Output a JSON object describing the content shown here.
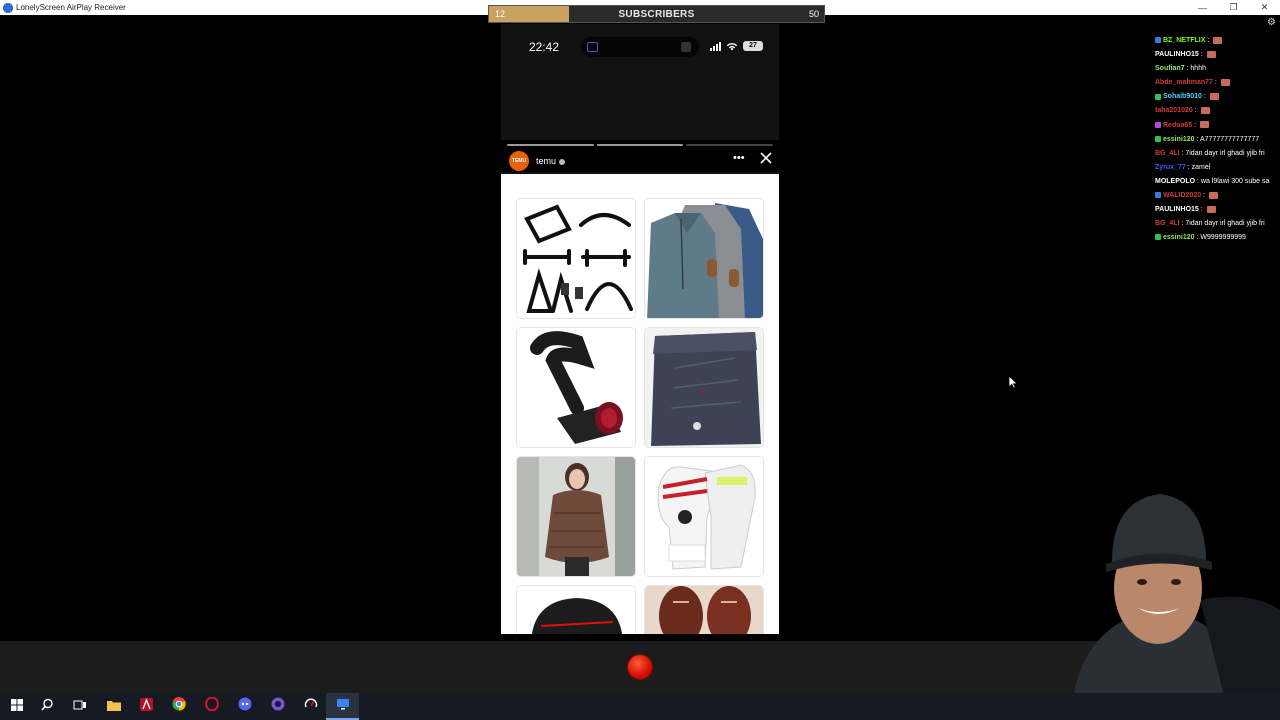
{
  "window": {
    "title": "LonelyScreen AirPlay Receiver",
    "controls": [
      "minimize-icon",
      "restore-icon",
      "close-icon"
    ]
  },
  "overlay": {
    "subscribers": {
      "current": "12",
      "label": "SUBSCRIBERS",
      "goal": "50",
      "progress": 0.24,
      "fill_color": "#c9a260"
    }
  },
  "phone": {
    "time": "22:42",
    "battery": "27",
    "story": {
      "account": "temu",
      "avatar_text": "TEMU",
      "segments": 3,
      "products": [
        "fitness-handles-image",
        "quarter-zip-sweaters-image",
        "air-intake-pipe-image",
        "jeans-image",
        "puffer-jacket-image",
        "goalkeeper-gloves-image",
        "helmet-image",
        "leather-shoes-image"
      ]
    }
  },
  "chat": {
    "messages": [
      {
        "user": "BZ_NETFLIX",
        "text": "",
        "color": "#7CFC00",
        "badge": "#3b7be0",
        "emote": true
      },
      {
        "user": "PAULINHO15",
        "text": "",
        "color": "#ffffff",
        "badge": "",
        "emote": true
      },
      {
        "user": "Soufian7",
        "text": "hhhh",
        "color": "#9be36b",
        "badge": "",
        "emote": false
      },
      {
        "user": "Abde_mahman77",
        "text": "",
        "color": "#d33a3a",
        "badge": "",
        "emote": true
      },
      {
        "user": "Sohaib9010",
        "text": "",
        "color": "#4fd3ff",
        "badge": "#2fbf55",
        "emote": true
      },
      {
        "user": "taha201020",
        "text": "",
        "color": "#d33a3a",
        "badge": "",
        "emote": true
      },
      {
        "user": "Redua65",
        "text": "",
        "color": "#d33a3a",
        "badge": "#b04ad0",
        "emote": true
      },
      {
        "user": "essini120",
        "text": "A77777777777777",
        "color": "#9be36b",
        "badge": "#2fbf55",
        "emote": false
      },
      {
        "user": "BG_4Ll",
        "text": "7idan dayr irl ghadi yjib fri",
        "color": "#d33a3a",
        "badge": "",
        "emote": false
      },
      {
        "user": "Zyrux_77",
        "text": "zamel",
        "color": "#3b5bff",
        "badge": "",
        "emote": false
      },
      {
        "user": "MOLEPOLO",
        "text": "wa l9lawi 300 sube sa",
        "color": "#ffffff",
        "badge": "",
        "emote": false
      },
      {
        "user": "WALID2020",
        "text": "",
        "color": "#d33a3a",
        "badge": "#3b7be0",
        "emote": true
      },
      {
        "user": "PAULINHO15",
        "text": "",
        "color": "#ffffff",
        "badge": "",
        "emote": true
      },
      {
        "user": "BG_4Ll",
        "text": "7idan dayr irl ghadi yjib fri",
        "color": "#d33a3a",
        "badge": "",
        "emote": false
      },
      {
        "user": "essini120",
        "text": "W9999999999",
        "color": "#9be36b",
        "badge": "#2fbf55",
        "emote": false
      }
    ]
  },
  "controls": {
    "record_color": "#d21000"
  },
  "taskbar": {
    "items": [
      "start-icon",
      "search-icon",
      "task-view-icon",
      "file-explorer-icon",
      "adobe-app-icon",
      "chrome-icon",
      "opera-icon",
      "discord-app-icon",
      "obs-app-icon",
      "speedtest-app-icon",
      "lonelyscreen-app-icon"
    ],
    "active_index": 10
  }
}
